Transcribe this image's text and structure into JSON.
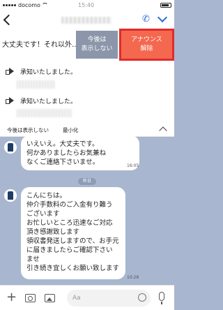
{
  "status_bar": {
    "carrier": "docomo",
    "clock": "15:40"
  },
  "header": {
    "title": "",
    "call_icon": "phone-icon",
    "menu_icon": "chevron-down-icon"
  },
  "announcement": {
    "text": "大丈夫です！それ以外…",
    "hide_label": "今後は\n表示しない",
    "unpin_label": "アナウンス\n解除",
    "items": [
      {
        "label": "承知いたしました。"
      },
      {
        "label": "承知いたしました。"
      }
    ],
    "footer_hide": "今後は表示しない",
    "footer_minimize": "最小化"
  },
  "chat": {
    "messages": [
      {
        "text": "いえいえ。大丈夫です。\n何かありましたらお気兼ね\nなくご連絡下さいませ。",
        "time": "16:05"
      },
      {
        "text": "こんにちは。\n仲介手数料のご入金有り難う\nございます\nお忙しいところ迅速なご対応\n頂き感謝致します\n領収書発送しますので、お手元\nに届きましたらご確認下さい\nませ\n引き続き宜しくお願い致します",
        "time": "10:28"
      }
    ],
    "date_separator": "昨日"
  },
  "input_bar": {
    "placeholder": "Aa"
  }
}
